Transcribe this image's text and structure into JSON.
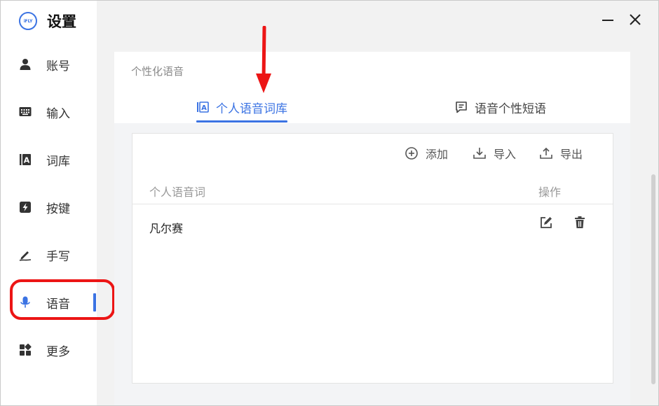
{
  "app": {
    "title": "设置",
    "logo_text": "iFLY"
  },
  "sidebar": {
    "items": [
      {
        "label": "账号",
        "icon": "person-icon"
      },
      {
        "label": "输入",
        "icon": "keyboard-icon"
      },
      {
        "label": "词库",
        "icon": "lexicon-icon"
      },
      {
        "label": "按键",
        "icon": "lightning-key-icon"
      },
      {
        "label": "手写",
        "icon": "pen-icon"
      },
      {
        "label": "语音",
        "icon": "microphone-icon",
        "active": true
      },
      {
        "label": "更多",
        "icon": "apps-icon"
      }
    ]
  },
  "panel": {
    "section_title": "个性化语音",
    "tabs": [
      {
        "label": "个人语音词库",
        "icon": "lexicon-tab-icon",
        "active": true
      },
      {
        "label": "语音个性短语",
        "icon": "phrase-icon",
        "active": false
      }
    ],
    "actions": {
      "add": "添加",
      "import": "导入",
      "export": "导出"
    },
    "table": {
      "columns": [
        "个人语音词",
        "操作"
      ],
      "rows": [
        {
          "word": "凡尔赛"
        }
      ]
    }
  },
  "colors": {
    "accent": "#3b73e3",
    "annotation": "#ec1515",
    "background": "#f2f2f2"
  }
}
